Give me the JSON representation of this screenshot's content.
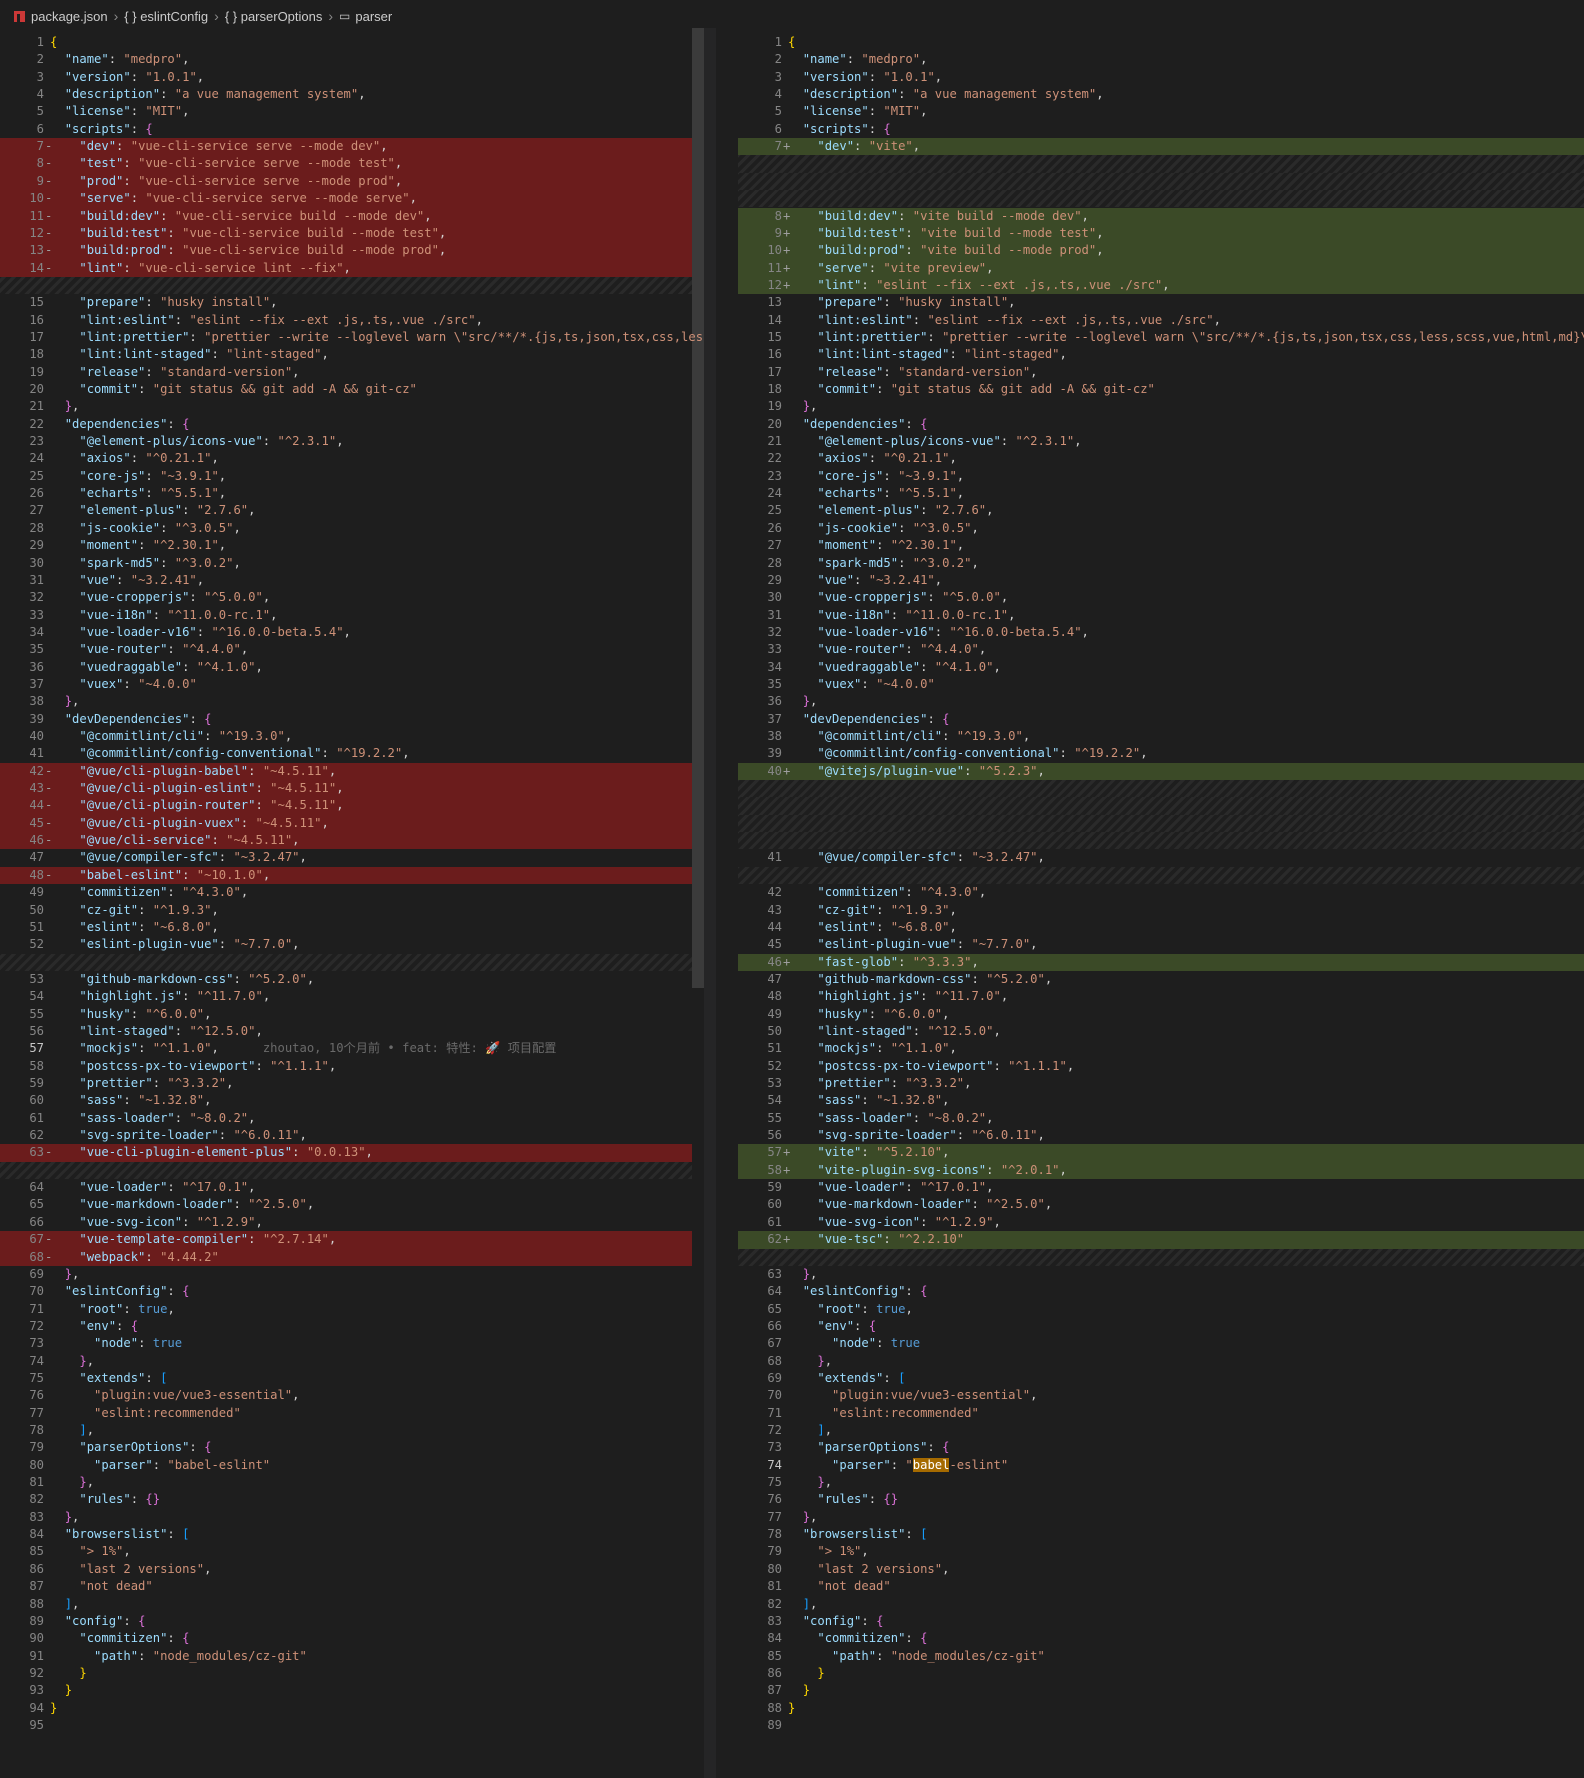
{
  "breadcrumb": {
    "file": "package.json",
    "items": [
      "{ } eslintConfig",
      "{ } parserOptions",
      "parser"
    ]
  },
  "left": {
    "rows": [
      {
        "n": "1",
        "t": "{"
      },
      {
        "n": "2",
        "t": "  \"name\": \"medpro\","
      },
      {
        "n": "3",
        "t": "  \"version\": \"1.0.1\","
      },
      {
        "n": "4",
        "t": "  \"description\": \"a vue management system\","
      },
      {
        "n": "5",
        "t": "  \"license\": \"MIT\","
      },
      {
        "n": "6",
        "t": "  \"scripts\": {"
      },
      {
        "n": "7",
        "m": "-",
        "d": "del",
        "t": "    \"dev\": \"vue-cli-service serve --mode dev\","
      },
      {
        "n": "8",
        "m": "-",
        "d": "del",
        "t": "    \"test\": \"vue-cli-service serve --mode test\","
      },
      {
        "n": "9",
        "m": "-",
        "d": "del",
        "t": "    \"prod\": \"vue-cli-service serve --mode prod\","
      },
      {
        "n": "10",
        "m": "-",
        "d": "del",
        "t": "    \"serve\": \"vue-cli-service serve --mode serve\","
      },
      {
        "n": "11",
        "m": "-",
        "d": "del",
        "t": "    \"build:dev\": \"vue-cli-service build --mode dev\","
      },
      {
        "n": "12",
        "m": "-",
        "d": "del",
        "t": "    \"build:test\": \"vue-cli-service build --mode test\","
      },
      {
        "n": "13",
        "m": "-",
        "d": "del",
        "t": "    \"build:prod\": \"vue-cli-service build --mode prod\","
      },
      {
        "n": "14",
        "m": "-",
        "d": "del",
        "t": "    \"lint\": \"vue-cli-service lint --fix\","
      },
      {
        "f": 1
      },
      {
        "n": "15",
        "t": "    \"prepare\": \"husky install\","
      },
      {
        "n": "16",
        "t": "    \"lint:eslint\": \"eslint --fix --ext .js,.ts,.vue ./src\","
      },
      {
        "n": "17",
        "t": "    \"lint:prettier\": \"prettier --write --loglevel warn \\\"src/**/*.{js,ts,json,tsx,css,less,scss"
      },
      {
        "n": "18",
        "t": "    \"lint:lint-staged\": \"lint-staged\","
      },
      {
        "n": "19",
        "t": "    \"release\": \"standard-version\","
      },
      {
        "n": "20",
        "t": "    \"commit\": \"git status && git add -A && git-cz\""
      },
      {
        "n": "21",
        "t": "  },"
      },
      {
        "n": "22",
        "t": "  \"dependencies\": {"
      },
      {
        "n": "23",
        "t": "    \"@element-plus/icons-vue\": \"^2.3.1\","
      },
      {
        "n": "24",
        "t": "    \"axios\": \"^0.21.1\","
      },
      {
        "n": "25",
        "t": "    \"core-js\": \"~3.9.1\","
      },
      {
        "n": "26",
        "t": "    \"echarts\": \"^5.5.1\","
      },
      {
        "n": "27",
        "t": "    \"element-plus\": \"2.7.6\","
      },
      {
        "n": "28",
        "t": "    \"js-cookie\": \"^3.0.5\","
      },
      {
        "n": "29",
        "t": "    \"moment\": \"^2.30.1\","
      },
      {
        "n": "30",
        "t": "    \"spark-md5\": \"^3.0.2\","
      },
      {
        "n": "31",
        "t": "    \"vue\": \"~3.2.41\","
      },
      {
        "n": "32",
        "t": "    \"vue-cropperjs\": \"^5.0.0\","
      },
      {
        "n": "33",
        "t": "    \"vue-i18n\": \"^11.0.0-rc.1\","
      },
      {
        "n": "34",
        "t": "    \"vue-loader-v16\": \"^16.0.0-beta.5.4\","
      },
      {
        "n": "35",
        "t": "    \"vue-router\": \"^4.4.0\","
      },
      {
        "n": "36",
        "t": "    \"vuedraggable\": \"^4.1.0\","
      },
      {
        "n": "37",
        "t": "    \"vuex\": \"~4.0.0\""
      },
      {
        "n": "38",
        "t": "  },"
      },
      {
        "n": "39",
        "t": "  \"devDependencies\": {"
      },
      {
        "n": "40",
        "t": "    \"@commitlint/cli\": \"^19.3.0\","
      },
      {
        "n": "41",
        "t": "    \"@commitlint/config-conventional\": \"^19.2.2\","
      },
      {
        "n": "42",
        "m": "-",
        "d": "del",
        "t": "    \"@vue/cli-plugin-babel\": \"~4.5.11\","
      },
      {
        "n": "43",
        "m": "-",
        "d": "del",
        "t": "    \"@vue/cli-plugin-eslint\": \"~4.5.11\","
      },
      {
        "n": "44",
        "m": "-",
        "d": "del",
        "t": "    \"@vue/cli-plugin-router\": \"~4.5.11\","
      },
      {
        "n": "45",
        "m": "-",
        "d": "del",
        "t": "    \"@vue/cli-plugin-vuex\": \"~4.5.11\","
      },
      {
        "n": "46",
        "m": "-",
        "d": "del",
        "t": "    \"@vue/cli-service\": \"~4.5.11\","
      },
      {
        "n": "47",
        "t": "    \"@vue/compiler-sfc\": \"~3.2.47\","
      },
      {
        "n": "48",
        "m": "-",
        "d": "del",
        "t": "    \"babel-eslint\": \"~10.1.0\","
      },
      {
        "n": "49",
        "t": "    \"commitizen\": \"^4.3.0\","
      },
      {
        "n": "50",
        "t": "    \"cz-git\": \"^1.9.3\","
      },
      {
        "n": "51",
        "t": "    \"eslint\": \"~6.8.0\","
      },
      {
        "n": "52",
        "t": "    \"eslint-plugin-vue\": \"~7.7.0\","
      },
      {
        "f": 1
      },
      {
        "n": "53",
        "t": "    \"github-markdown-css\": \"^5.2.0\","
      },
      {
        "n": "54",
        "t": "    \"highlight.js\": \"^11.7.0\","
      },
      {
        "n": "55",
        "t": "    \"husky\": \"^6.0.0\","
      },
      {
        "n": "56",
        "t": "    \"lint-staged\": \"^12.5.0\","
      },
      {
        "n": "57",
        "a": 1,
        "t": "    \"mockjs\": \"^1.1.0\",",
        "b": "      zhoutao, 10个月前 • feat: 特性: 🚀 项目配置"
      },
      {
        "n": "58",
        "t": "    \"postcss-px-to-viewport\": \"^1.1.1\","
      },
      {
        "n": "59",
        "t": "    \"prettier\": \"^3.3.2\","
      },
      {
        "n": "60",
        "t": "    \"sass\": \"~1.32.8\","
      },
      {
        "n": "61",
        "t": "    \"sass-loader\": \"~8.0.2\","
      },
      {
        "n": "62",
        "t": "    \"svg-sprite-loader\": \"^6.0.11\","
      },
      {
        "n": "63",
        "m": "-",
        "d": "del",
        "t": "    \"vue-cli-plugin-element-plus\": \"0.0.13\","
      },
      {
        "f": 1
      },
      {
        "n": "64",
        "t": "    \"vue-loader\": \"^17.0.1\","
      },
      {
        "n": "65",
        "t": "    \"vue-markdown-loader\": \"^2.5.0\","
      },
      {
        "n": "66",
        "t": "    \"vue-svg-icon\": \"^1.2.9\","
      },
      {
        "n": "67",
        "m": "-",
        "d": "del",
        "t": "    \"vue-template-compiler\": \"^2.7.14\","
      },
      {
        "n": "68",
        "m": "-",
        "d": "del",
        "t": "    \"webpack\": \"4.44.2\""
      },
      {
        "n": "69",
        "t": "  },"
      },
      {
        "n": "70",
        "t": "  \"eslintConfig\": {"
      },
      {
        "n": "71",
        "t": "    \"root\": true,"
      },
      {
        "n": "72",
        "t": "    \"env\": {"
      },
      {
        "n": "73",
        "t": "      \"node\": true"
      },
      {
        "n": "74",
        "t": "    },"
      },
      {
        "n": "75",
        "t": "    \"extends\": ["
      },
      {
        "n": "76",
        "t": "      \"plugin:vue/vue3-essential\","
      },
      {
        "n": "77",
        "t": "      \"eslint:recommended\""
      },
      {
        "n": "78",
        "t": "    ],"
      },
      {
        "n": "79",
        "t": "    \"parserOptions\": {"
      },
      {
        "n": "80",
        "t": "      \"parser\": \"babel-eslint\""
      },
      {
        "n": "81",
        "t": "    },"
      },
      {
        "n": "82",
        "t": "    \"rules\": {}"
      },
      {
        "n": "83",
        "t": "  },"
      },
      {
        "n": "84",
        "t": "  \"browserslist\": ["
      },
      {
        "n": "85",
        "t": "    \"> 1%\","
      },
      {
        "n": "86",
        "t": "    \"last 2 versions\","
      },
      {
        "n": "87",
        "t": "    \"not dead\""
      },
      {
        "n": "88",
        "t": "  ],"
      },
      {
        "n": "89",
        "t": "  \"config\": {"
      },
      {
        "n": "90",
        "t": "    \"commitizen\": {"
      },
      {
        "n": "91",
        "t": "      \"path\": \"node_modules/cz-git\""
      },
      {
        "n": "92",
        "t": "    }"
      },
      {
        "n": "93",
        "t": "  }"
      },
      {
        "n": "94",
        "t": "}"
      },
      {
        "n": "95",
        "t": ""
      }
    ]
  },
  "right": {
    "rows": [
      {
        "n": "1",
        "t": "{"
      },
      {
        "n": "2",
        "t": "  \"name\": \"medpro\","
      },
      {
        "n": "3",
        "t": "  \"version\": \"1.0.1\","
      },
      {
        "n": "4",
        "t": "  \"description\": \"a vue management system\","
      },
      {
        "n": "5",
        "t": "  \"license\": \"MIT\","
      },
      {
        "n": "6",
        "t": "  \"scripts\": {"
      },
      {
        "n": "7",
        "m": "+",
        "d": "ins",
        "t": "    \"dev\": \"vite\","
      },
      {
        "f": 1
      },
      {
        "f": 1
      },
      {
        "f": 1
      },
      {
        "n": "8",
        "m": "+",
        "d": "ins",
        "t": "    \"build:dev\": \"vite build --mode dev\","
      },
      {
        "n": "9",
        "m": "+",
        "d": "ins",
        "t": "    \"build:test\": \"vite build --mode test\","
      },
      {
        "n": "10",
        "m": "+",
        "d": "ins",
        "t": "    \"build:prod\": \"vite build --mode prod\","
      },
      {
        "n": "11",
        "m": "+",
        "d": "ins",
        "t": "    \"serve\": \"vite preview\","
      },
      {
        "n": "12",
        "m": "+",
        "d": "ins",
        "t": "    \"lint\": \"eslint --fix --ext .js,.ts,.vue ./src\","
      },
      {
        "n": "13",
        "t": "    \"prepare\": \"husky install\","
      },
      {
        "n": "14",
        "t": "    \"lint:eslint\": \"eslint --fix --ext .js,.ts,.vue ./src\","
      },
      {
        "n": "15",
        "t": "    \"lint:prettier\": \"prettier --write --loglevel warn \\\"src/**/*.{js,ts,json,tsx,css,less,scss,vue,html,md}\\\"\","
      },
      {
        "n": "16",
        "t": "    \"lint:lint-staged\": \"lint-staged\","
      },
      {
        "n": "17",
        "t": "    \"release\": \"standard-version\","
      },
      {
        "n": "18",
        "t": "    \"commit\": \"git status && git add -A && git-cz\""
      },
      {
        "n": "19",
        "t": "  },"
      },
      {
        "n": "20",
        "t": "  \"dependencies\": {"
      },
      {
        "n": "21",
        "t": "    \"@element-plus/icons-vue\": \"^2.3.1\","
      },
      {
        "n": "22",
        "t": "    \"axios\": \"^0.21.1\","
      },
      {
        "n": "23",
        "t": "    \"core-js\": \"~3.9.1\","
      },
      {
        "n": "24",
        "t": "    \"echarts\": \"^5.5.1\","
      },
      {
        "n": "25",
        "t": "    \"element-plus\": \"2.7.6\","
      },
      {
        "n": "26",
        "t": "    \"js-cookie\": \"^3.0.5\","
      },
      {
        "n": "27",
        "t": "    \"moment\": \"^2.30.1\","
      },
      {
        "n": "28",
        "t": "    \"spark-md5\": \"^3.0.2\","
      },
      {
        "n": "29",
        "t": "    \"vue\": \"~3.2.41\","
      },
      {
        "n": "30",
        "t": "    \"vue-cropperjs\": \"^5.0.0\","
      },
      {
        "n": "31",
        "t": "    \"vue-i18n\": \"^11.0.0-rc.1\","
      },
      {
        "n": "32",
        "t": "    \"vue-loader-v16\": \"^16.0.0-beta.5.4\","
      },
      {
        "n": "33",
        "t": "    \"vue-router\": \"^4.4.0\","
      },
      {
        "n": "34",
        "t": "    \"vuedraggable\": \"^4.1.0\","
      },
      {
        "n": "35",
        "t": "    \"vuex\": \"~4.0.0\""
      },
      {
        "n": "36",
        "t": "  },"
      },
      {
        "n": "37",
        "t": "  \"devDependencies\": {"
      },
      {
        "n": "38",
        "t": "    \"@commitlint/cli\": \"^19.3.0\","
      },
      {
        "n": "39",
        "t": "    \"@commitlint/config-conventional\": \"^19.2.2\","
      },
      {
        "n": "40",
        "m": "+",
        "d": "ins",
        "t": "    \"@vitejs/plugin-vue\": \"^5.2.3\","
      },
      {
        "f": 1
      },
      {
        "f": 1
      },
      {
        "f": 1
      },
      {
        "f": 1
      },
      {
        "n": "41",
        "t": "    \"@vue/compiler-sfc\": \"~3.2.47\","
      },
      {
        "f": 1
      },
      {
        "n": "42",
        "t": "    \"commitizen\": \"^4.3.0\","
      },
      {
        "n": "43",
        "t": "    \"cz-git\": \"^1.9.3\","
      },
      {
        "n": "44",
        "t": "    \"eslint\": \"~6.8.0\","
      },
      {
        "n": "45",
        "t": "    \"eslint-plugin-vue\": \"~7.7.0\","
      },
      {
        "n": "46",
        "m": "+",
        "d": "ins",
        "t": "    \"fast-glob\": \"^3.3.3\","
      },
      {
        "n": "47",
        "t": "    \"github-markdown-css\": \"^5.2.0\","
      },
      {
        "n": "48",
        "t": "    \"highlight.js\": \"^11.7.0\","
      },
      {
        "n": "49",
        "t": "    \"husky\": \"^6.0.0\","
      },
      {
        "n": "50",
        "t": "    \"lint-staged\": \"^12.5.0\","
      },
      {
        "n": "51",
        "t": "    \"mockjs\": \"^1.1.0\","
      },
      {
        "n": "52",
        "t": "    \"postcss-px-to-viewport\": \"^1.1.1\","
      },
      {
        "n": "53",
        "t": "    \"prettier\": \"^3.3.2\","
      },
      {
        "n": "54",
        "t": "    \"sass\": \"~1.32.8\","
      },
      {
        "n": "55",
        "t": "    \"sass-loader\": \"~8.0.2\","
      },
      {
        "n": "56",
        "t": "    \"svg-sprite-loader\": \"^6.0.11\","
      },
      {
        "n": "57",
        "m": "+",
        "d": "ins",
        "t": "    \"vite\": \"^5.2.10\","
      },
      {
        "n": "58",
        "m": "+",
        "d": "ins",
        "t": "    \"vite-plugin-svg-icons\": \"^2.0.1\","
      },
      {
        "n": "59",
        "t": "    \"vue-loader\": \"^17.0.1\","
      },
      {
        "n": "60",
        "t": "    \"vue-markdown-loader\": \"^2.5.0\","
      },
      {
        "n": "61",
        "t": "    \"vue-svg-icon\": \"^1.2.9\","
      },
      {
        "n": "62",
        "m": "+",
        "d": "ins",
        "t": "    \"vue-tsc\": \"^2.2.10\""
      },
      {
        "f": 1
      },
      {
        "n": "63",
        "t": "  },"
      },
      {
        "n": "64",
        "t": "  \"eslintConfig\": {"
      },
      {
        "n": "65",
        "t": "    \"root\": true,"
      },
      {
        "n": "66",
        "t": "    \"env\": {"
      },
      {
        "n": "67",
        "t": "      \"node\": true"
      },
      {
        "n": "68",
        "t": "    },"
      },
      {
        "n": "69",
        "t": "    \"extends\": ["
      },
      {
        "n": "70",
        "t": "      \"plugin:vue/vue3-essential\","
      },
      {
        "n": "71",
        "t": "      \"eslint:recommended\""
      },
      {
        "n": "72",
        "t": "    ],"
      },
      {
        "n": "73",
        "t": "    \"parserOptions\": {"
      },
      {
        "n": "74",
        "a": 1,
        "h": "babel",
        "t": "      \"parser\": \"babel-eslint\""
      },
      {
        "n": "75",
        "t": "    },"
      },
      {
        "n": "76",
        "t": "    \"rules\": {}"
      },
      {
        "n": "77",
        "t": "  },"
      },
      {
        "n": "78",
        "t": "  \"browserslist\": ["
      },
      {
        "n": "79",
        "t": "    \"> 1%\","
      },
      {
        "n": "80",
        "t": "    \"last 2 versions\","
      },
      {
        "n": "81",
        "t": "    \"not dead\""
      },
      {
        "n": "82",
        "t": "  ],"
      },
      {
        "n": "83",
        "t": "  \"config\": {"
      },
      {
        "n": "84",
        "t": "    \"commitizen\": {"
      },
      {
        "n": "85",
        "t": "      \"path\": \"node_modules/cz-git\""
      },
      {
        "n": "86",
        "t": "    }"
      },
      {
        "n": "87",
        "t": "  }"
      },
      {
        "n": "88",
        "t": "}"
      },
      {
        "n": "89",
        "t": ""
      }
    ]
  }
}
